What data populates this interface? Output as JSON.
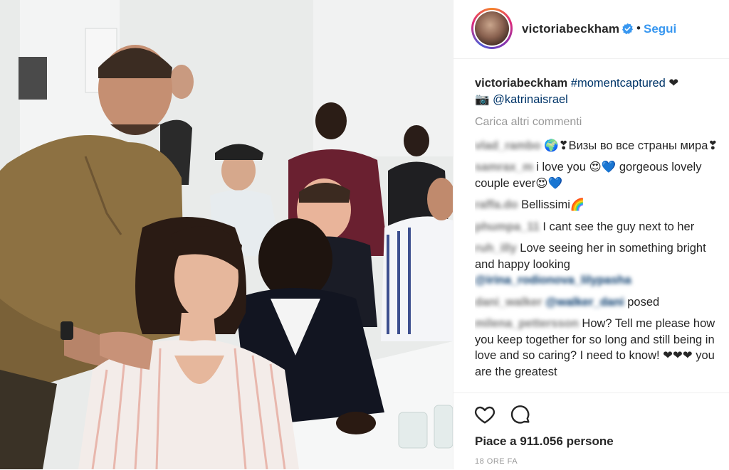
{
  "post": {
    "username": "victoriabeckham",
    "follow_label": "Segui",
    "dot": "•"
  },
  "caption": {
    "username": "victoriabeckham",
    "hashtag": "#momentcaptured",
    "heart": "❤",
    "camera": "📷",
    "mention": "@katrinaisrael"
  },
  "load_more": "Carica altri commenti",
  "comments": [
    {
      "user": "vlad_rambo",
      "text": "🌍❣Визы во все страны мира❣"
    },
    {
      "user": "samrax_m",
      "text": "i love you 😍💙 gorgeous lovely couple ever😍💙"
    },
    {
      "user": "raffa.do",
      "text": "Bellissimi🌈"
    },
    {
      "user": "phumpa_11",
      "text": "I cant see the guy next to her"
    },
    {
      "user": "ruh_illy",
      "text": "Love seeing her in something bright and happy looking"
    },
    {
      "user": "",
      "mention": "@irina_rodionova_lilypasha",
      "text": ""
    },
    {
      "user": "dani_walker",
      "mention": "@walker_dani",
      "text": "posed"
    },
    {
      "user": "milena_pettersson",
      "text": "How? Tell me please how you keep together for so long and still being in love and so caring? I need to know! ❤❤❤ you are the greatest"
    }
  ],
  "likes": "Piace a 911.056 persone",
  "time": "18 ORE FA",
  "colors": {
    "accent": "#3897f0",
    "link": "#003569",
    "text": "#262626",
    "muted": "#999999"
  }
}
